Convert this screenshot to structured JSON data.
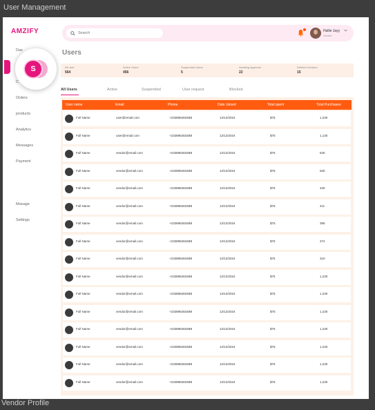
{
  "frame": {
    "title": "User Management",
    "bottom_label": "Vendor Profile"
  },
  "app": {
    "logo": "AMZIFY"
  },
  "sidebar": {
    "active_initial": "S",
    "items": [
      {
        "label": "Das"
      },
      {
        "label": "C"
      },
      {
        "label": "Orders"
      },
      {
        "label": "products"
      },
      {
        "label": "Analytics"
      },
      {
        "label": "Messages"
      },
      {
        "label": "Payment"
      },
      {
        "label": "Manage"
      },
      {
        "label": "Settings"
      }
    ]
  },
  "search": {
    "placeholder": "Search",
    "value": ""
  },
  "user": {
    "name": "Hallie Jayy",
    "role": "Vendor"
  },
  "page": {
    "title": "Users"
  },
  "stats": [
    {
      "label": "All user",
      "value": "564"
    },
    {
      "label": "Active Users",
      "value": "456"
    },
    {
      "label": "Suspended Users",
      "value": "5"
    },
    {
      "label": "Awaiting Approval",
      "value": "22"
    },
    {
      "label": "Deleted Vendors",
      "value": "15"
    }
  ],
  "filters": [
    "All Users",
    "Active",
    "Suspended",
    "User request",
    "Blocked"
  ],
  "table": {
    "headers": [
      "User name",
      "Email",
      "Phone",
      "Date Joined",
      "Total spent",
      "Total Purchases"
    ],
    "rows": [
      {
        "name": "Full Name",
        "email": "user@email.com",
        "phone": "+2338962834B9",
        "date": "12/12/2024",
        "spent": "$75",
        "purchases": "1,230"
      },
      {
        "name": "Full Name",
        "email": "user@email.com",
        "phone": "+2338962834B9",
        "date": "12/12/2024",
        "spent": "$75",
        "purchases": "1,130"
      },
      {
        "name": "Full Name",
        "email": "vendor@email.com",
        "phone": "+2338962834B9",
        "date": "12/12/2024",
        "spent": "$75",
        "purchases": "630"
      },
      {
        "name": "Full Name",
        "email": "vendor@email.com",
        "phone": "+2338962834B9",
        "date": "12/12/2024",
        "spent": "$75",
        "purchases": "530"
      },
      {
        "name": "Full Name",
        "email": "vendor@email.com",
        "phone": "+2338962834B9",
        "date": "12/12/2024",
        "spent": "$75",
        "purchases": "430"
      },
      {
        "name": "Full Name",
        "email": "vendor@email.com",
        "phone": "+2338962834B9",
        "date": "12/12/2024",
        "spent": "$75",
        "purchases": "411"
      },
      {
        "name": "Full Name",
        "email": "vendor@email.com",
        "phone": "+2338962834B9",
        "date": "12/12/2024",
        "spent": "$75",
        "purchases": "395"
      },
      {
        "name": "Full Name",
        "email": "vendor@email.com",
        "phone": "+2338962834B9",
        "date": "12/12/2024",
        "spent": "$75",
        "purchases": "374"
      },
      {
        "name": "Full Name",
        "email": "vendor@email.com",
        "phone": "+2338962834B9",
        "date": "12/12/2024",
        "spent": "$75",
        "purchases": "310"
      },
      {
        "name": "Full Name",
        "email": "vendor@email.com",
        "phone": "+2338962834B9",
        "date": "12/12/2024",
        "spent": "$75",
        "purchases": "1,230"
      },
      {
        "name": "Full Name",
        "email": "vendor@email.com",
        "phone": "+2338962834B9",
        "date": "12/12/2024",
        "spent": "$75",
        "purchases": "1,230"
      },
      {
        "name": "Full Name",
        "email": "vendor@email.com",
        "phone": "+2338962834B9",
        "date": "12/12/2024",
        "spent": "$75",
        "purchases": "1,230"
      },
      {
        "name": "Full Name",
        "email": "vendor@email.com",
        "phone": "+2338962834B9",
        "date": "12/12/2024",
        "spent": "$75",
        "purchases": "1,230"
      },
      {
        "name": "Full Name",
        "email": "vendor@email.com",
        "phone": "+2338962834B9",
        "date": "12/12/2024",
        "spent": "$75",
        "purchases": "1,230"
      },
      {
        "name": "Full Name",
        "email": "vendor@email.com",
        "phone": "+2338962834B9",
        "date": "12/12/2024",
        "spent": "$75",
        "purchases": "1,230"
      },
      {
        "name": "Full Name",
        "email": "vendor@email.com",
        "phone": "+2338962834B9",
        "date": "12/12/2024",
        "spent": "$75",
        "purchases": "1,230"
      }
    ]
  },
  "colors": {
    "brand": "#e6157d",
    "table_header": "#ff5c10",
    "stats_bg": "#fdefe5",
    "topbar_bg": "#fdeaf2"
  },
  "icons": {
    "search": "search-icon",
    "notification": "bell-icon",
    "dropdown": "chevron-down-icon"
  }
}
